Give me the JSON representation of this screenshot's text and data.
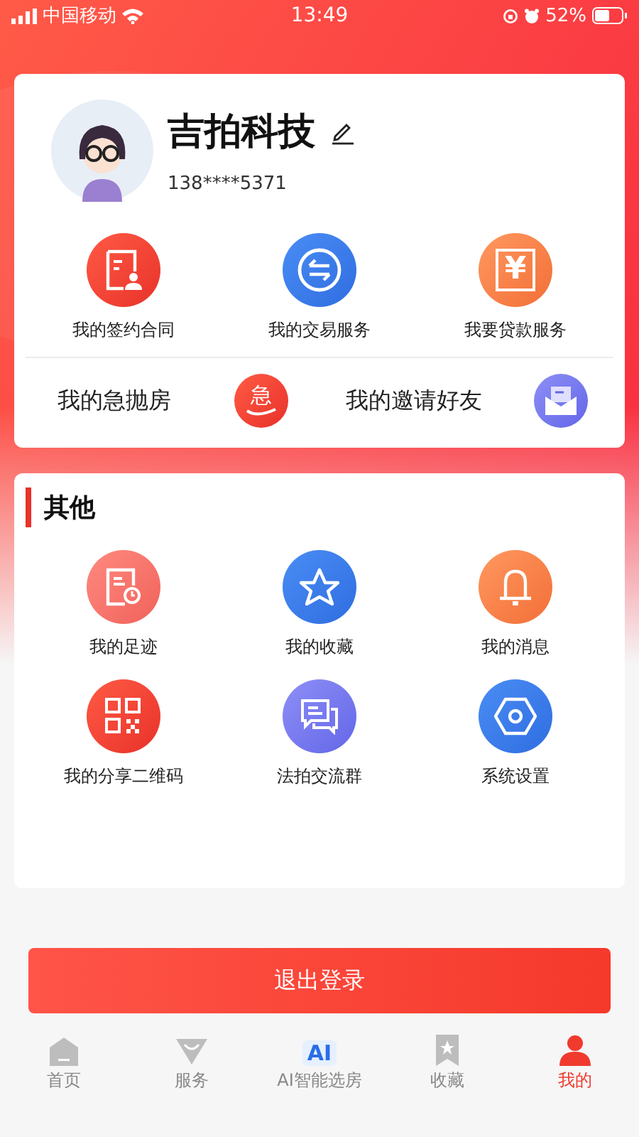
{
  "status_bar": {
    "carrier": "中国移动",
    "time": "13:49",
    "battery": "52%"
  },
  "profile": {
    "name": "吉拍科技",
    "phone": "138****5371"
  },
  "services": [
    {
      "label": "我的签约合同",
      "kind": "contract"
    },
    {
      "label": "我的交易服务",
      "kind": "exchange"
    },
    {
      "label": "我要贷款服务",
      "kind": "loan",
      "icon_text": "¥"
    }
  ],
  "shortcuts": [
    {
      "label": "我的急抛房",
      "kind": "urgent",
      "icon_text": "急"
    },
    {
      "label": "我的邀请好友",
      "kind": "invite"
    }
  ],
  "other": {
    "title": "其他",
    "items": [
      {
        "label": "我的足迹",
        "kind": "history"
      },
      {
        "label": "我的收藏",
        "kind": "star"
      },
      {
        "label": "我的消息",
        "kind": "bell"
      },
      {
        "label": "我的分享二维码",
        "kind": "qr"
      },
      {
        "label": "法拍交流群",
        "kind": "chat"
      },
      {
        "label": "系统设置",
        "kind": "settings"
      }
    ]
  },
  "logout_button": "退出登录",
  "tabs": [
    {
      "label": "首页",
      "kind": "home",
      "selected": false
    },
    {
      "label": "服务",
      "kind": "service",
      "selected": false
    },
    {
      "label": "AI智能选房",
      "kind": "ai",
      "icon_text": "AI",
      "selected": false
    },
    {
      "label": "收藏",
      "kind": "bookmark",
      "selected": false
    },
    {
      "label": "我的",
      "kind": "me",
      "selected": true
    }
  ]
}
